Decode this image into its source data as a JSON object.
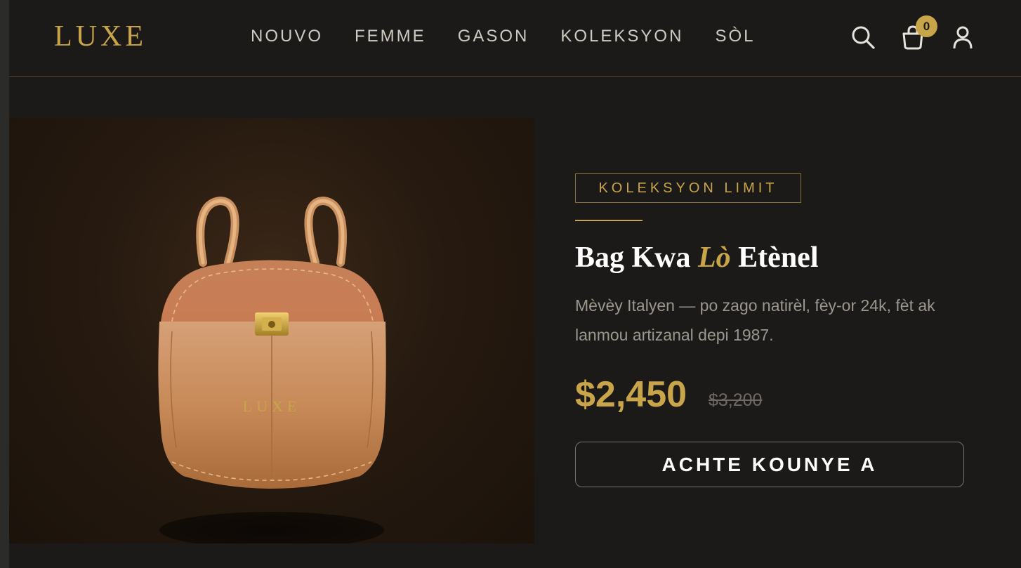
{
  "header": {
    "logo": "LUXE",
    "nav": [
      "NOUVO",
      "FEMME",
      "GASON",
      "KOLEKSYON",
      "SÒL"
    ],
    "cart_count": "0"
  },
  "product": {
    "badge": "KOLEKSYON LIMIT",
    "title_part1": "Bag Kwa ",
    "title_accent": "Lò",
    "title_part2": " Etènel",
    "description": "Mèvèy Italyen — po zago natirèl, fèy-or 24k, fèt ak lanmou artizanal depi 1987.",
    "price": "$2,450",
    "old_price": "$3,200",
    "buy_label": "ACHTE KOUNYE A",
    "bag_brand": "LUXE"
  },
  "colors": {
    "accent": "#c9a54a",
    "background": "#1c1a18",
    "leather": "#c98a5a"
  },
  "icons": [
    "search-icon",
    "shopping-bag-icon",
    "user-icon"
  ]
}
